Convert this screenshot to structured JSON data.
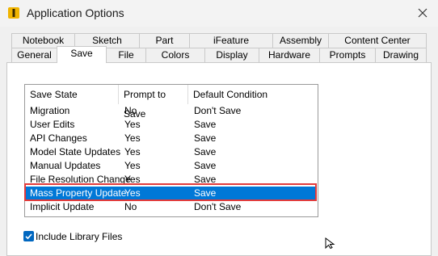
{
  "window": {
    "title": "Application Options"
  },
  "tabs_row1": [
    "Notebook",
    "Sketch",
    "Part",
    "iFeature",
    "Assembly",
    "Content Center"
  ],
  "tabs_row2": [
    "General",
    "Save",
    "File",
    "Colors",
    "Display",
    "Hardware",
    "Prompts",
    "Drawing"
  ],
  "active_tab": "Save",
  "table": {
    "headers": [
      "Save State",
      "Prompt to Save",
      "Default Condition"
    ],
    "rows": [
      [
        "Migration",
        "No",
        "Don't Save"
      ],
      [
        "User Edits",
        "Yes",
        "Save"
      ],
      [
        "API Changes",
        "Yes",
        "Save"
      ],
      [
        "Model State Updates",
        "Yes",
        "Save"
      ],
      [
        "Manual Updates",
        "Yes",
        "Save"
      ],
      [
        "File Resolution Change",
        "Yes",
        "Save"
      ],
      [
        "Mass Property Update",
        "Yes",
        "Save"
      ],
      [
        "Implicit Update",
        "No",
        "Don't Save"
      ]
    ],
    "selected_row": 6
  },
  "checkbox": {
    "label": "Include Library Files",
    "checked": true
  },
  "colors": {
    "selection": "#0078d7",
    "highlight_box": "#e23a3a",
    "checkbox": "#0067c0"
  },
  "icons": {
    "app": "app-icon",
    "close": "close-icon",
    "check": "check-icon",
    "cursor": "mouse-cursor-icon"
  }
}
